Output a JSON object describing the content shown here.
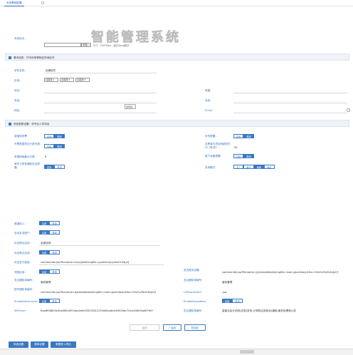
{
  "tab": {
    "label": "系统基础配置"
  },
  "logo_field": {
    "label": "系统标志：",
    "browse_label": "浏览...",
    "hint": "尺寸：300*40px，建议为png格式",
    "watermark": "智能管理系统"
  },
  "section_basic": {
    "title": "基本信息：打印存单等相应的地址写"
  },
  "basic": {
    "school_name_label": "学校名称：",
    "school_name_value": "迈威软件",
    "region_label": "区域：",
    "select_placeholder": "请选择",
    "address_label": "地址：",
    "postcode_label": "邮编：",
    "phone_label": "电话：",
    "fax_label": "传真：",
    "website_label": "网站：",
    "email_label": "Email：",
    "tooltip": "启动后..."
  },
  "section_params": {
    "title": "系统参数设置：非专业人员勿动"
  },
  "params": {
    "enable": "启用",
    "disable": "禁用",
    "row1_left_label": "增值税发票：",
    "row1_right_label": "未号提醒：",
    "row2_left_label": "开票数据导出行数列表：",
    "row2_right_label": "发票单位项目明细项打印（条/张）：",
    "row2_right_value": "50",
    "row3_left_label": "单据明细最大行数：",
    "row3_left_value": "6",
    "row3_right_label": "账户余额提醒：",
    "row4_left_label": "邮件与短信通知发送提醒：",
    "row4_right_label": "查询模式：",
    "mode_options": [
      "手工",
      "每天",
      "每周",
      "每月"
    ]
  },
  "lower": {
    "r1_label": "微课收入：",
    "r2_label": "自动发送账户：",
    "r3_label": "存证是否启用：",
    "r3_value": "全部选择",
    "r4_label": "存证是否启用：",
    "r5_label": "存证支付链接：",
    "r5_value": "commonlist.jsp?filename=kcjsyjdzd&mgfile=guanlianjcyxdzx%3d[xl]",
    "r6_left_label": "流程启用：",
    "r6_right_label": "收支账务设置：",
    "r6_right_value": "commonlist.jsp?filename=jyjcmbjsfbtzds&mgfile=main:guanlianjc4lks=%5a%25b%3d[xl]?",
    "r7_left_label": "发证通知单编号：",
    "r7_left_value": "营收管理",
    "r7_right_label": "发证通知单编号：",
    "r7_right_value": "营收管理",
    "r8_left_label": "配号通知单编号：",
    "r8_left_value": "commonlist.jsp?filename=jkjsmbjfbzdzd&mgfile=main:guanlianjc4lks=%5a%25b%3d[xl]?",
    "r8_right_label": "UrlRewriteExt：",
    "r8_right_value": ".jsp",
    "r9_left_label": "EnableDataCache：",
    "r9_right_label": "EnableDeepWare：",
    "r10_left_label": "SMSUser：",
    "r10_left_value": "Bae8f06800e4ba0861697aaa4d9d33023242135a64aa6cb64926dc7b1a346d3aa6f760f",
    "r10_right_label": "发证通知单编号：",
    "r10_right_value": "智能化会计系统(应急)发改-计算机应用技术(通用)事务处理和公务"
  },
  "actions": {
    "back": "返回",
    "save": "√ 保存",
    "reset": "初始化"
  },
  "footer_buttons": {
    "b1": "系统设置",
    "b2": "账单设置",
    "b3": "数据导入导出"
  }
}
